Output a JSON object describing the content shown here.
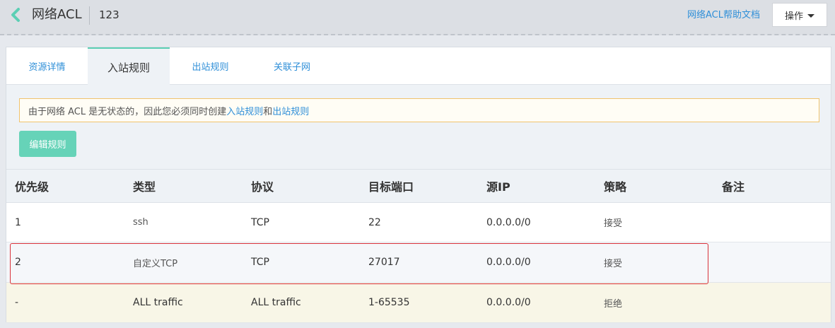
{
  "header": {
    "title": "网络ACL",
    "acl_name": "123",
    "help_link": "网络ACL帮助文档",
    "ops_label": "操作"
  },
  "tabs": [
    {
      "label": "资源详情"
    },
    {
      "label": "入站规则",
      "active": true
    },
    {
      "label": "出站规则"
    },
    {
      "label": "关联子网"
    }
  ],
  "notice": {
    "prefix": "由于网络 ACL 是无状态的，因此您必须同时创建",
    "link1": "入站规则",
    "middle": "和",
    "link2": "出站规则"
  },
  "edit_button": "编辑规则",
  "table": {
    "headers": [
      "优先级",
      "类型",
      "协议",
      "目标端口",
      "源IP",
      "策略",
      "备注"
    ],
    "rows": [
      {
        "priority": "1",
        "type": "ssh",
        "protocol": "TCP",
        "port": "22",
        "source_ip": "0.0.0.0/0",
        "policy": "接受",
        "note": ""
      },
      {
        "priority": "2",
        "type": "自定义TCP",
        "protocol": "TCP",
        "port": "27017",
        "source_ip": "0.0.0.0/0",
        "policy": "接受",
        "note": "",
        "highlighted": true
      },
      {
        "priority": "-",
        "type": "ALL traffic",
        "protocol": "ALL traffic",
        "port": "1-65535",
        "source_ip": "0.0.0.0/0",
        "policy": "拒绝",
        "note": ""
      }
    ]
  },
  "colors": {
    "accent": "#5ccfb4",
    "link": "#2f8fd8",
    "highlight": "#d9323a"
  }
}
